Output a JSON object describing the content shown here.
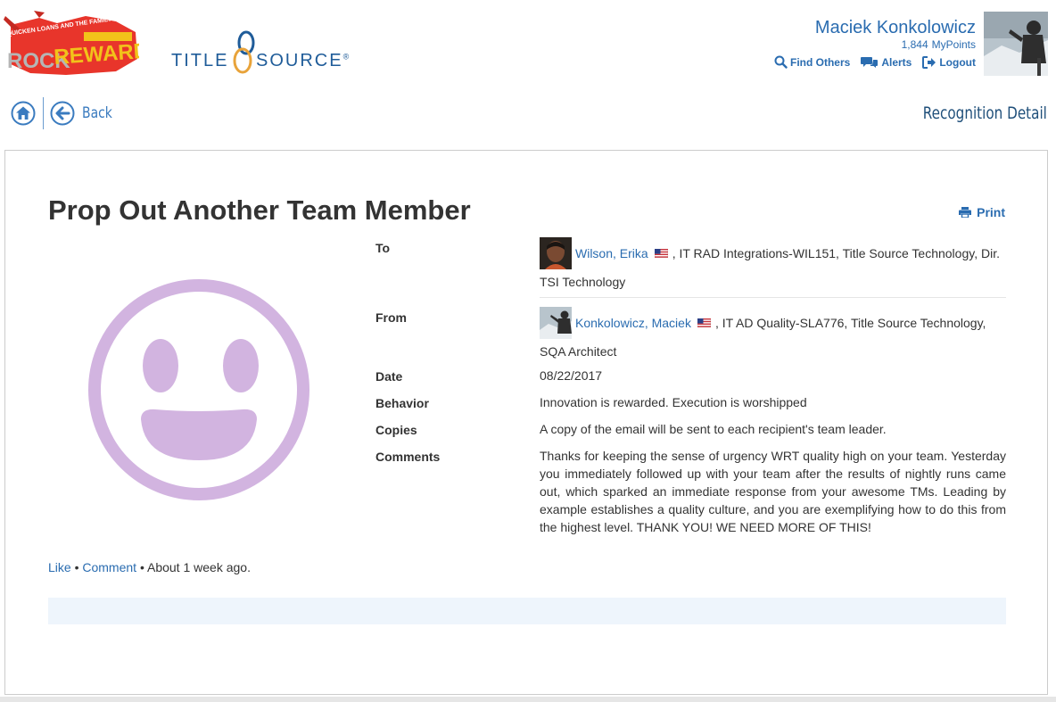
{
  "header": {
    "rock_logo": {
      "tagline": "QUICKEN LOANS AND THE FAMILY OF COMPANIES",
      "word1": "ROCK",
      "word2": "REWARDS"
    },
    "title_logo": {
      "part1": "TITLE",
      "part2": "SOURCE",
      "mark": "®"
    },
    "user": {
      "name": "Maciek Konkolowicz",
      "points": "1,844",
      "points_label": "MyPoints",
      "avatar_icon": "user-avatar-photo"
    },
    "links": [
      {
        "label": "Find Others",
        "icon": "search-icon"
      },
      {
        "label": "Alerts",
        "icon": "alerts-icon"
      },
      {
        "label": "Logout",
        "icon": "logout-icon"
      }
    ]
  },
  "nav": {
    "home_icon": "home-icon",
    "back_label": "Back",
    "page_heading": "Recognition Detail"
  },
  "card": {
    "title": "Prop Out Another Team Member",
    "print_label": "Print",
    "badge_icon": "smiley-face-icon",
    "details": {
      "to": {
        "label": "To",
        "name": "Wilson, Erika",
        "desc_line1": ", IT RAD Integrations-WIL151, Title Source Technology, Dir.",
        "desc_line2": "TSI Technology"
      },
      "from": {
        "label": "From",
        "name": "Konkolowicz, Maciek",
        "desc_line1": ", IT AD Quality-SLA776, Title Source Technology,",
        "desc_line2": "SQA Architect"
      },
      "date": {
        "label": "Date",
        "value": "08/22/2017"
      },
      "behavior": {
        "label": "Behavior",
        "value": "Innovation is rewarded. Execution is worshipped"
      },
      "copies": {
        "label": "Copies",
        "value": "A copy of the email will be sent to each recipient's team leader."
      },
      "comments": {
        "label": "Comments",
        "value": "Thanks for keeping the sense of urgency WRT quality high on your team. Yesterday you immediately followed up with your team after the results of nightly runs came out, which sparked an immediate response from your awesome TMs. Leading by example establishes a quality culture, and you are exemplifying how to do this from the highest level. THANK YOU! WE NEED MORE OF THIS!"
      }
    },
    "social": {
      "like": "Like",
      "sep": " • ",
      "comment": "Comment",
      "time": "About 1 week ago."
    }
  },
  "colors": {
    "link_blue": "#2a6cb0",
    "heading_blue": "#1f4f7a",
    "smiley_purple": "#d2b4e0",
    "comment_box": "#eef5fc"
  }
}
